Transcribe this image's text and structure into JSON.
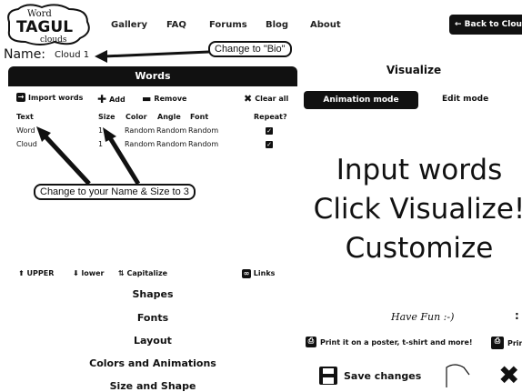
{
  "header": {
    "logo_lines": [
      "Word",
      "TAGUL",
      "clouds"
    ],
    "nav": [
      "Gallery",
      "FAQ",
      "Forums",
      "Blog",
      "About"
    ],
    "back_button": "← Back to Clouds"
  },
  "name": {
    "label": "Name:",
    "value": "Cloud 1"
  },
  "callouts": {
    "bio": "Change to \"Bio\"",
    "name_size": "Change to your Name & Size to 3"
  },
  "words_panel": {
    "title": "Words",
    "toolbar": {
      "import": "Import words",
      "add": "Add",
      "remove": "Remove",
      "clear": "Clear all"
    },
    "columns": [
      "Text",
      "Size",
      "Color",
      "Angle",
      "Font",
      "Repeat?"
    ],
    "rows": [
      {
        "text": "Word",
        "size": "1",
        "color": "Random",
        "angle": "Random",
        "font": "Random",
        "repeat": true
      },
      {
        "text": "Cloud",
        "size": "1",
        "color": "Random",
        "angle": "Random",
        "font": "Random",
        "repeat": true
      }
    ],
    "case_tools": {
      "upper": "UPPER",
      "lower": "lower",
      "capitalize": "Capitalize",
      "links": "Links"
    },
    "sections": [
      "Shapes",
      "Fonts",
      "Layout",
      "Colors and Animations",
      "Size and Shape"
    ]
  },
  "visualize": {
    "title": "Visualize",
    "tabs": {
      "animation": "Animation mode",
      "edit": "Edit mode"
    },
    "placeholder_lines": [
      "Input words",
      "Click Visualize!",
      "Customize"
    ],
    "fun": "Have Fun :-)",
    "print_poster": "Print it on a poster, t-shirt and more!",
    "print_short": "Prin",
    "save": "Save changes"
  }
}
